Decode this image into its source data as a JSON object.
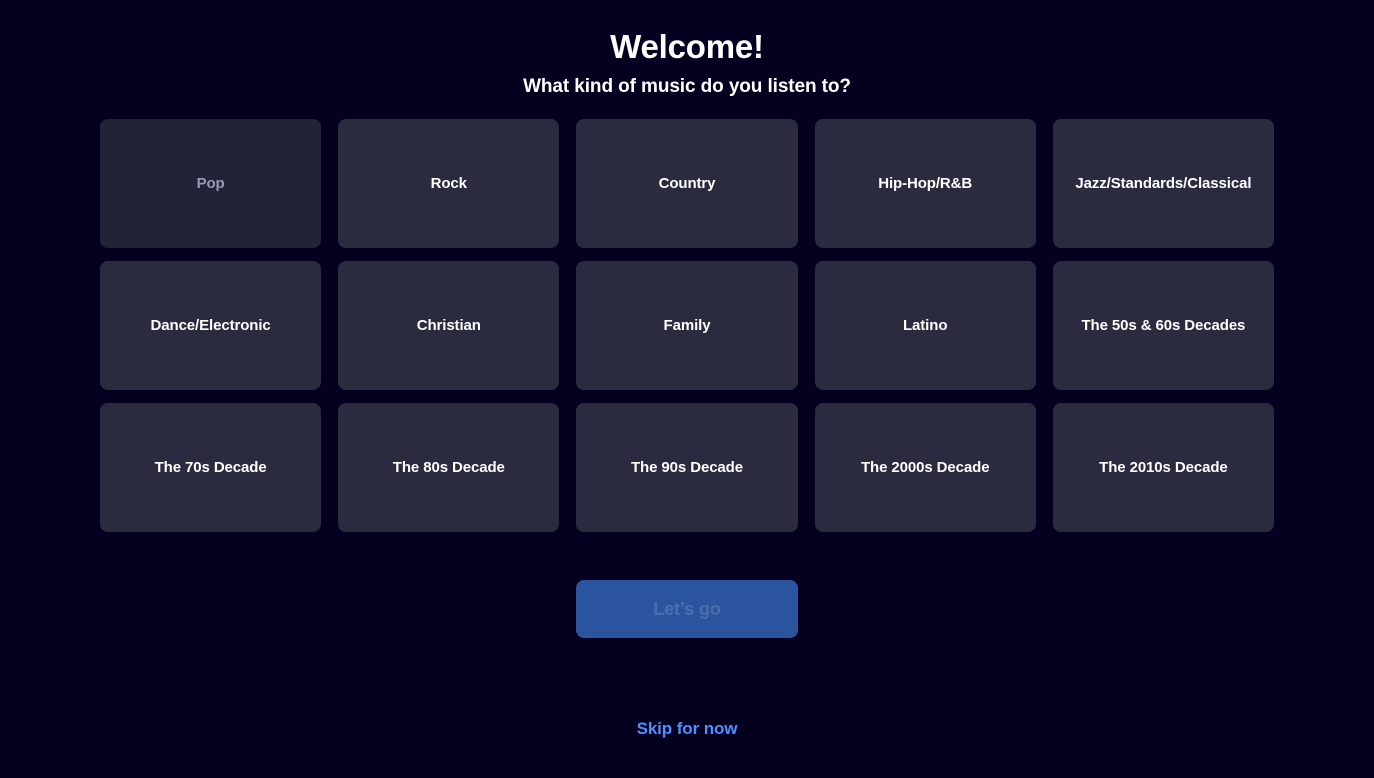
{
  "header": {
    "title": "Welcome!",
    "subtitle": "What kind of music do you listen to?"
  },
  "genres": [
    {
      "label": "Pop",
      "state": "active"
    },
    {
      "label": "Rock",
      "state": "normal"
    },
    {
      "label": "Country",
      "state": "normal"
    },
    {
      "label": "Hip-Hop/R&B",
      "state": "normal"
    },
    {
      "label": "Jazz/Standards/Classical",
      "state": "normal"
    },
    {
      "label": "Dance/Electronic",
      "state": "normal"
    },
    {
      "label": "Christian",
      "state": "normal"
    },
    {
      "label": "Family",
      "state": "normal"
    },
    {
      "label": "Latino",
      "state": "normal"
    },
    {
      "label": "The 50s & 60s Decades",
      "state": "normal"
    },
    {
      "label": "The 70s Decade",
      "state": "normal"
    },
    {
      "label": "The 80s Decade",
      "state": "normal"
    },
    {
      "label": "The 90s Decade",
      "state": "normal"
    },
    {
      "label": "The 2000s Decade",
      "state": "normal"
    },
    {
      "label": "The 2010s Decade",
      "state": "normal"
    }
  ],
  "actions": {
    "submit_label": "Let’s go",
    "skip_label": "Skip for now"
  },
  "colors": {
    "page_background": "#060020",
    "card_background": "#2b2b3f",
    "card_background_active": "#232338",
    "card_text": "#ffffff",
    "card_text_active": "#9a9ab0",
    "button_background": "#2a549d",
    "button_text": "#4a6fae",
    "link_text": "#4d90fe"
  }
}
